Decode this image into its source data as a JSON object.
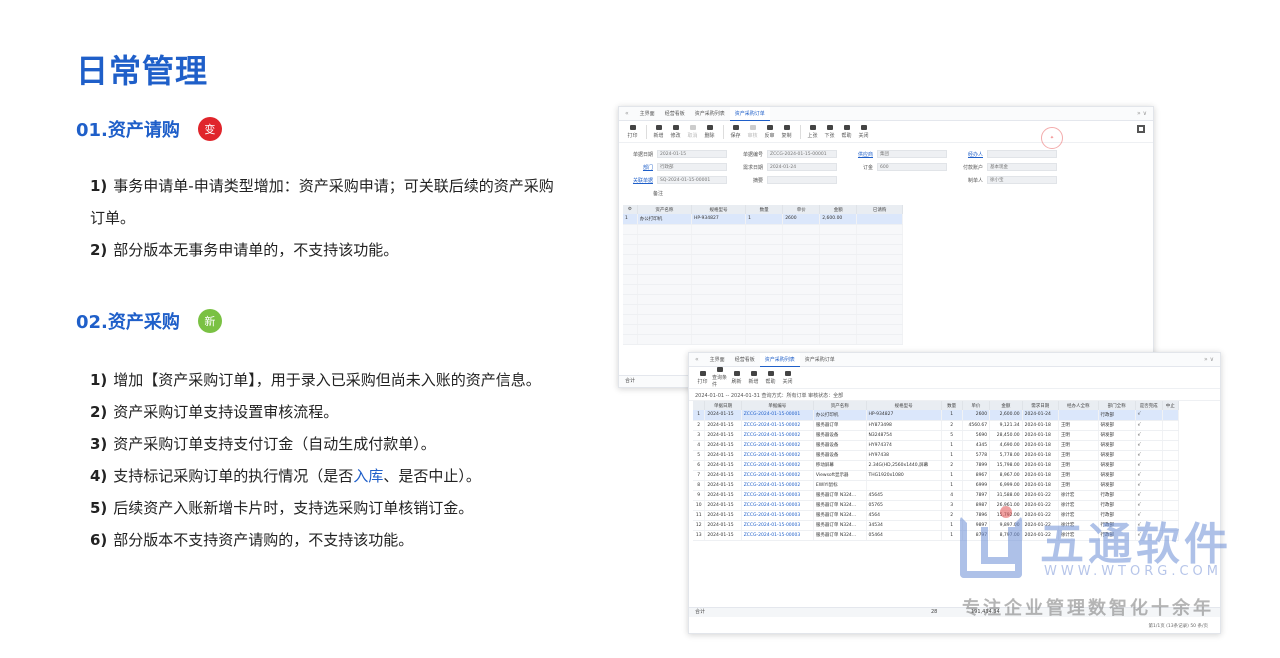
{
  "page": {
    "title": "日常管理"
  },
  "section1": {
    "title": "01.资产请购",
    "badge": "变",
    "badge_color": "#e0252b",
    "items": [
      {
        "num": "1)",
        "text": "事务申请单-申请类型增加：资产采购申请；可关联后续的资产采购订单。"
      },
      {
        "num": "2)",
        "text": "部分版本无事务申请单的，不支持该功能。"
      }
    ]
  },
  "section2": {
    "title": "02.资产采购",
    "badge": "新",
    "badge_color": "#7ac143",
    "items": [
      {
        "num": "1)",
        "text": "增加【资产采购订单】，用于录入已采购但尚未入账的资产信息。"
      },
      {
        "num": "2)",
        "text": "资产采购订单支持设置审核流程。"
      },
      {
        "num": "3)",
        "text": "资产采购订单支持支付订金（自动生成付款单）。"
      },
      {
        "num": "4)",
        "text_before": "支持标记采购订单的执行情况（是否",
        "text_highlight": "入库",
        "text_after": "、是否中止）。"
      },
      {
        "num": "5)",
        "text": "后续资产入账新增卡片时，支持选采购订单核销订金。"
      },
      {
        "num": "6)",
        "text": "部分版本不支持资产请购的，不支持该功能。"
      }
    ]
  },
  "win1": {
    "tabs": [
      "主界面",
      "经营看板",
      "资产采购列表",
      "资产采购订单"
    ],
    "active_tab": 3,
    "toolbar": [
      "打印",
      "新增",
      "修改",
      "取消",
      "删除",
      "保存",
      "审核",
      "反审",
      "复制",
      "上张",
      "下张",
      "帮助",
      "关闭"
    ],
    "form": {
      "rows": [
        [
          {
            "label": "单据日期",
            "value": "2024-01-15"
          },
          {
            "label": "单据编号",
            "value": "ZCCG-2024-01-15-00001"
          },
          {
            "label": "供应商",
            "value": "集团",
            "link": true
          },
          {
            "label": "经办人",
            "value": "",
            "link": true
          }
        ],
        [
          {
            "label": "部门",
            "value": "行政部",
            "link": true
          },
          {
            "label": "需求日期",
            "value": "2024-01-24"
          },
          {
            "label": "订金",
            "value": "600"
          },
          {
            "label": "付款账户",
            "value": "基本现金"
          }
        ],
        [
          {
            "label": "关联单据",
            "value": "SQ-2024-01-15-00001",
            "link": true
          },
          {
            "label": "摘要",
            "value": ""
          },
          {
            "label": "",
            "value": ""
          },
          {
            "label": "制单人",
            "value": "徐小宝"
          }
        ]
      ],
      "remark": "备注"
    },
    "grid": {
      "headers": [
        "资产名称",
        "规格型号",
        "数量",
        "单价",
        "金额",
        "已请购"
      ],
      "rows": [
        [
          "办公打印机",
          "HP-934827",
          "1",
          "2600",
          "2,600.00",
          ""
        ]
      ]
    },
    "footer": "合计"
  },
  "win2": {
    "tabs": [
      "主界面",
      "经营看板",
      "资产采购列表",
      "资产采购订单"
    ],
    "active_tab": 2,
    "toolbar": [
      "打印",
      "查询条件",
      "刷新",
      "新增",
      "帮助",
      "关闭"
    ],
    "filter": "2024-01-01 -- 2024-01-31   查询方式：所有订单   审核状态：全部",
    "grid": {
      "headers": [
        "",
        "单据日期",
        "单据编号",
        "资产名称",
        "规格型号",
        "数量",
        "单价",
        "金额",
        "需求日期",
        "经办人全称",
        "部门全称",
        "是否完成",
        "中止"
      ],
      "rows": [
        [
          "1",
          "2024-01-15",
          "ZCCG-2024-01-15-00001",
          "办公打印机",
          "HP-934827",
          "1",
          "2600",
          "2,600.00",
          "2024-01-24",
          "",
          "行政部",
          "√",
          ""
        ],
        [
          "2",
          "2024-01-15",
          "ZCCG-2024-01-15-00002",
          "服务器订单",
          "HY873498",
          "2",
          "4560.67",
          "9,121.34",
          "2024-01-18",
          "王明",
          "研发部",
          "√",
          ""
        ],
        [
          "3",
          "2024-01-15",
          "ZCCG-2024-01-15-00002",
          "服务器设备",
          "N3248754",
          "5",
          "5690",
          "28,450.00",
          "2024-01-18",
          "王明",
          "研发部",
          "√",
          ""
        ],
        [
          "4",
          "2024-01-15",
          "ZCCG-2024-01-15-00002",
          "服务器设备",
          "HY974374",
          "1",
          "4345",
          "4,690.00",
          "2024-01-18",
          "王明",
          "研发部",
          "√",
          ""
        ],
        [
          "5",
          "2024-01-15",
          "ZCCG-2024-01-15-00002",
          "服务器设备",
          "HY97438",
          "1",
          "5778",
          "5,778.00",
          "2024-01-18",
          "王明",
          "研发部",
          "√",
          ""
        ],
        [
          "6",
          "2024-01-15",
          "ZCCG-2024-01-15-00002",
          "移动屏幕",
          "2.34G(HD,2560x1440,屏幕",
          "2",
          "7899",
          "15,798.00",
          "2024-01-18",
          "王明",
          "研发部",
          "√",
          ""
        ],
        [
          "7",
          "2024-01-15",
          "ZCCG-2024-01-15-00002",
          "Viewsoft显示器",
          "THG1920x1080",
          "1",
          "8967",
          "8,967.00",
          "2024-01-18",
          "王明",
          "研发部",
          "√",
          ""
        ],
        [
          "8",
          "2024-01-15",
          "ZCCG-2024-01-15-00002",
          "EWIYI鼠标",
          "",
          "1",
          "6999",
          "6,999.00",
          "2024-01-18",
          "王明",
          "研发部",
          "√",
          ""
        ],
        [
          "9",
          "2024-01-15",
          "ZCCG-2024-01-15-00003",
          "服务器订单 N324...",
          "45645",
          "4",
          "7897",
          "31,588.00",
          "2024-01-22",
          "徐计宏",
          "行政部",
          "√",
          ""
        ],
        [
          "10",
          "2024-01-15",
          "ZCCG-2024-01-15-00003",
          "服务器订单 N324...",
          "05765",
          "3",
          "8987",
          "26,961.00",
          "2024-01-22",
          "徐计宏",
          "行政部",
          "√",
          ""
        ],
        [
          "11",
          "2024-01-15",
          "ZCCG-2024-01-15-00003",
          "服务器订单 N324...",
          "4564",
          "2",
          "7896",
          "15,792.00",
          "2024-01-22",
          "徐计宏",
          "行政部",
          "√",
          ""
        ],
        [
          "12",
          "2024-01-15",
          "ZCCG-2024-01-15-00003",
          "服务器订单 N324...",
          "34534",
          "1",
          "9897",
          "9,897.00",
          "2024-01-22",
          "徐计宏",
          "行政部",
          "√",
          ""
        ],
        [
          "13",
          "2024-01-15",
          "ZCCG-2024-01-15-00003",
          "服务器订单 N324...",
          "05464",
          "1",
          "8797",
          "8,797.00",
          "2024-01-22",
          "徐计宏",
          "行政部",
          "√",
          ""
        ]
      ]
    },
    "footer": {
      "label": "合计",
      "qty": "28",
      "amount": "191,434.34"
    },
    "pager": "第1/1页 (13条记录)   50   条/页"
  },
  "watermark": {
    "name": "五通软件",
    "url": "WWW.WTORG.COM",
    "slogan": "专注企业管理数智化十余年",
    "brand_color": "#6d8fd6",
    "dot_color": "#e45353"
  }
}
